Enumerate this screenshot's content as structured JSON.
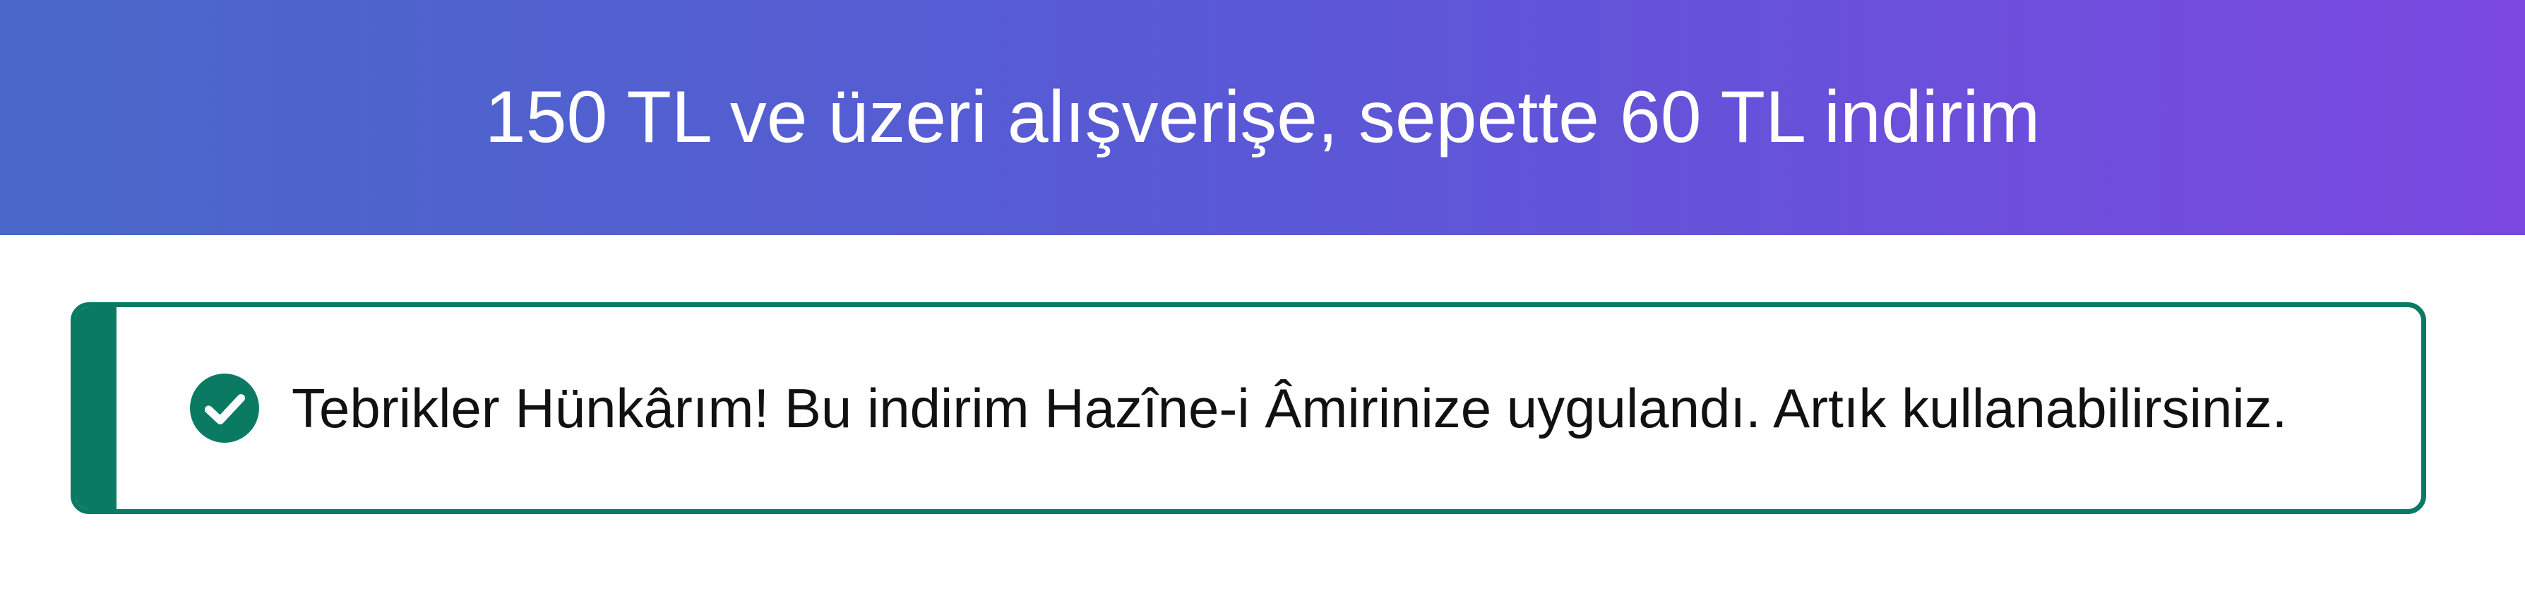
{
  "banner": {
    "title": "150 TL ve üzeri alışverişe, sepette 60 TL indirim"
  },
  "alert": {
    "icon": "check-circle-icon",
    "message": "Tebrikler Hünkârım! Bu indirim Hazîne-i Âmirinize uygulandı. Artık kullanabilirsiniz."
  },
  "colors": {
    "banner_gradient_start": "#4a68c9",
    "banner_gradient_end": "#7a48df",
    "success_green": "#0b7a62"
  }
}
